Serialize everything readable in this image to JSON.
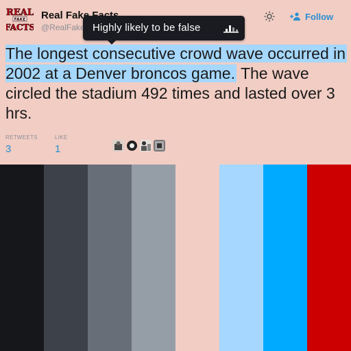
{
  "account": {
    "display_name": "Real Fake Facts",
    "handle": "@RealFake",
    "avatar_logo_text": "REAL FAKE FACTS"
  },
  "tooltip": {
    "text": "Highly likely to be false",
    "icon": "bar-chart-icon"
  },
  "actions": {
    "settings_icon": "gear-icon",
    "follow_label": "Follow",
    "follow_icon": "add-user-icon"
  },
  "tweet": {
    "highlighted_text": "The longest consecutive crowd wave occurred in 2002 at a Denver broncos game.",
    "rest_text": "The wave circled the stadium 492 times and lasted over 3 hrs."
  },
  "stats": {
    "retweets_label": "RETWEETS",
    "retweets_count": "3",
    "likes_label": "LIKE",
    "likes_count": "1"
  },
  "likers": [
    "avatar-1",
    "avatar-2",
    "avatar-3",
    "avatar-4"
  ],
  "colors": {
    "background": "#f1cdc3",
    "accent": "#2a8ed3",
    "highlight": "#a6d7ff",
    "palette": [
      "#15171b",
      "#3d4149",
      "#676e78",
      "#959ea6",
      "#f1cdc3",
      "#a6d7ff",
      "#00aaff",
      "#cc0000"
    ]
  }
}
